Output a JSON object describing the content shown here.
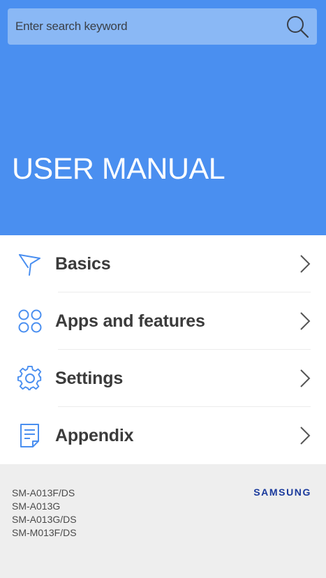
{
  "search": {
    "placeholder": "Enter search keyword",
    "icon": "search-icon"
  },
  "header": {
    "title": "USER MANUAL",
    "background_color": "#4a8ff0"
  },
  "menu": {
    "items": [
      {
        "label": "Basics",
        "icon": "flag-icon"
      },
      {
        "label": "Apps and features",
        "icon": "apps-grid-icon"
      },
      {
        "label": "Settings",
        "icon": "gear-icon"
      },
      {
        "label": "Appendix",
        "icon": "document-icon"
      }
    ],
    "icon_color": "#4a8ff0"
  },
  "footer": {
    "models": [
      "SM-A013F/DS",
      "SM-A013G",
      "SM-A013G/DS",
      "SM-M013F/DS"
    ],
    "brand": "SAMSUNG",
    "brand_color": "#1a3a9c"
  }
}
